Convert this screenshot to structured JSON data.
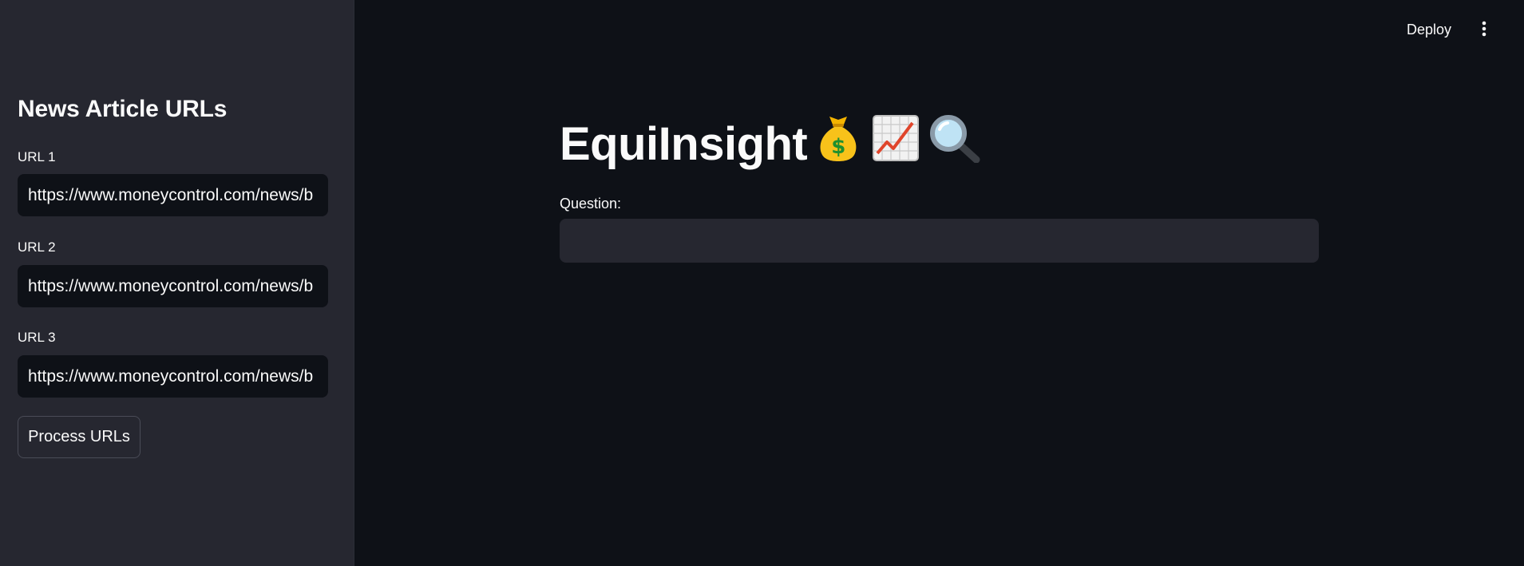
{
  "sidebar": {
    "title": "News Article URLs",
    "urls": [
      {
        "label": "URL 1",
        "value": "https://www.moneycontrol.com/news/b"
      },
      {
        "label": "URL 2",
        "value": "https://www.moneycontrol.com/news/b"
      },
      {
        "label": "URL 3",
        "value": "https://www.moneycontrol.com/news/b"
      }
    ],
    "process_button": "Process URLs"
  },
  "header": {
    "deploy_label": "Deploy",
    "menu_icon": "kebab-menu-icon"
  },
  "main": {
    "title": "EquiInsight",
    "title_icons": [
      "money-bag-icon",
      "chart-increasing-icon",
      "magnifying-glass-icon"
    ],
    "question_label": "Question:",
    "question_value": ""
  },
  "colors": {
    "background": "#0e1117",
    "sidebar": "#262730",
    "input_dark": "#0e1117",
    "input_light": "#262730",
    "text": "#fafafa"
  }
}
